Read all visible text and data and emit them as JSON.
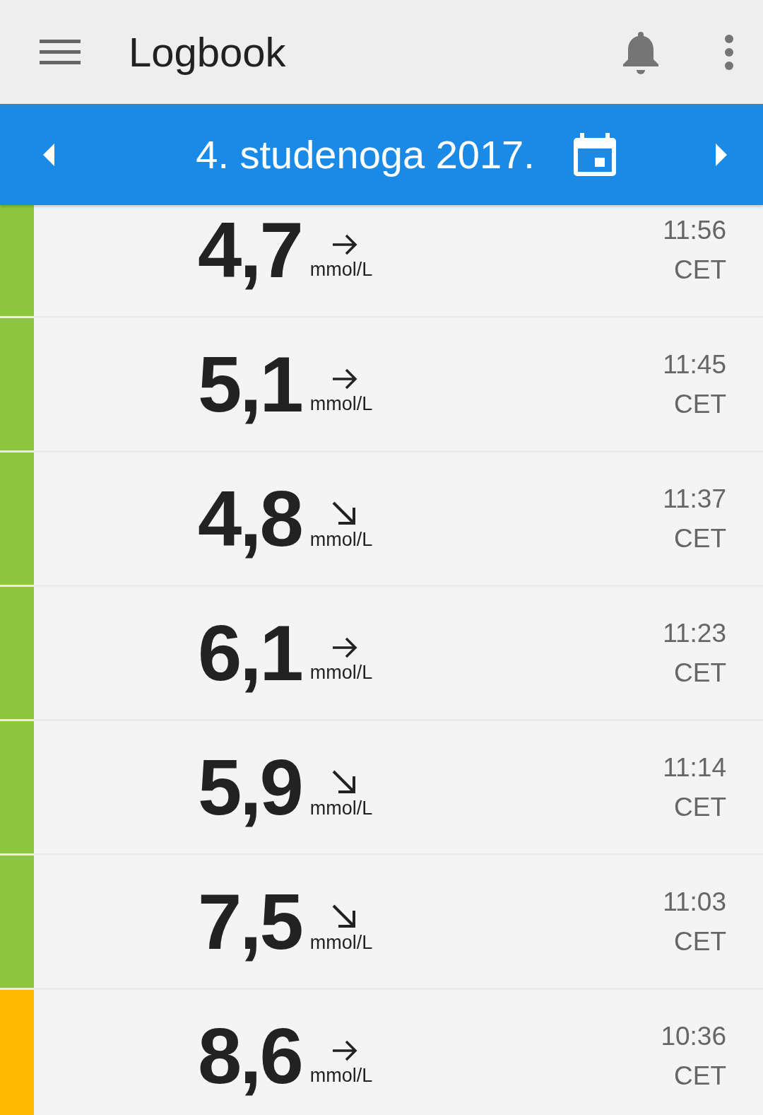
{
  "app_bar": {
    "title": "Logbook"
  },
  "date_bar": {
    "date": "4. studenoga 2017."
  },
  "readings": [
    {
      "value": "4,7",
      "kind": "flat",
      "unit": "mmol/L",
      "time": "11:56",
      "zone": "CET",
      "color": "#8dc63f"
    },
    {
      "value": "5,1",
      "kind": "flat",
      "unit": "mmol/L",
      "time": "11:45",
      "zone": "CET",
      "color": "#8dc63f"
    },
    {
      "value": "4,8",
      "kind": "down",
      "unit": "mmol/L",
      "time": "11:37",
      "zone": "CET",
      "color": "#8dc63f"
    },
    {
      "value": "6,1",
      "kind": "flat",
      "unit": "mmol/L",
      "time": "11:23",
      "zone": "CET",
      "color": "#8dc63f"
    },
    {
      "value": "5,9",
      "kind": "down",
      "unit": "mmol/L",
      "time": "11:14",
      "zone": "CET",
      "color": "#8dc63f"
    },
    {
      "value": "7,5",
      "kind": "down",
      "unit": "mmol/L",
      "time": "11:03",
      "zone": "CET",
      "color": "#8dc63f"
    },
    {
      "value": "8,6",
      "kind": "flat",
      "unit": "mmol/L",
      "time": "10:36",
      "zone": "CET",
      "color": "#ffba00"
    }
  ]
}
